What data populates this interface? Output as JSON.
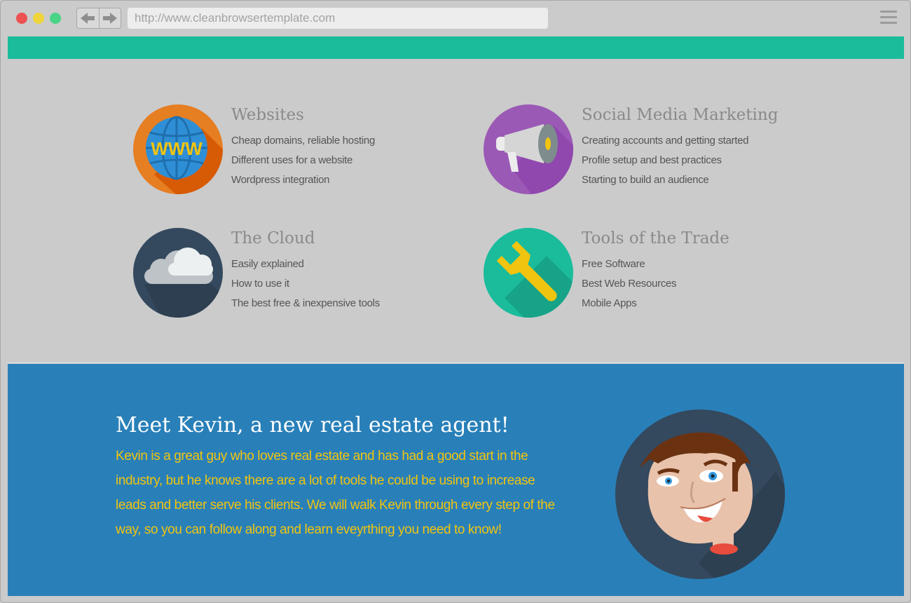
{
  "browser": {
    "url": "http://www.cleanbrowsertemplate.com",
    "back_icon": "arrow-left-icon",
    "forward_icon": "arrow-right-icon",
    "menu_icon": "hamburger-icon"
  },
  "colors": {
    "accent_green": "#1abc9c",
    "hero_blue": "#2980b9",
    "hero_text": "#f1c40f",
    "websites_icon": "#e67e22",
    "social_icon": "#9b59b6",
    "cloud_icon": "#34495e",
    "tools_icon": "#1abc9c"
  },
  "topics": [
    {
      "title": "Websites",
      "icon": "globe-www-icon",
      "items": [
        "Cheap domains, reliable hosting",
        "Different uses for a website",
        "Wordpress integration"
      ]
    },
    {
      "title": "Social Media Marketing",
      "icon": "megaphone-icon",
      "items": [
        "Creating accounts and getting started",
        "Profile setup and best practices",
        "Starting to build an audience"
      ]
    },
    {
      "title": "The Cloud",
      "icon": "cloud-icon",
      "items": [
        "Easily explained",
        "How to use it",
        "The best free & inexpensive tools"
      ]
    },
    {
      "title": "Tools of the Trade",
      "icon": "wrench-icon",
      "items": [
        "Free Software",
        "Best Web Resources",
        "Mobile Apps"
      ]
    }
  ],
  "globe_label": "WWW",
  "hero": {
    "title": "Meet Kevin, a new real estate agent!",
    "body": "Kevin is a great guy who loves real estate and has had a good start in the industry, but he knows there are a lot of tools he could be using to increase leads and better serve his clients. We will walk Kevin through every step of the way, so you can follow along and learn eveyrthing you need to know!",
    "avatar_icon": "kevin-avatar-icon"
  }
}
